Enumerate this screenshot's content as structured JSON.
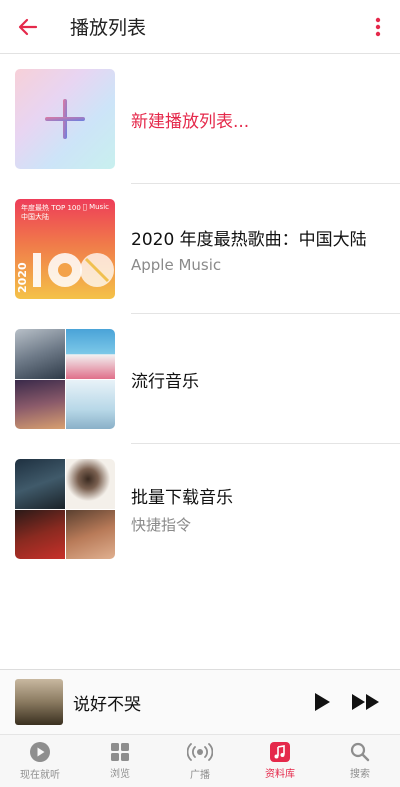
{
  "header": {
    "title": "播放列表"
  },
  "playlists": [
    {
      "title": "新建播放列表...",
      "subtitle": ""
    },
    {
      "title": "2020 年度最热歌曲：中国大陆",
      "subtitle": "Apple Music",
      "cover_lines": [
        "年度最热",
        "TOP 100",
        "中国大陆",
        "2020"
      ],
      "cover_brand": "Music"
    },
    {
      "title": "流行音乐",
      "subtitle": ""
    },
    {
      "title": "批量下载音乐",
      "subtitle": "快捷指令"
    }
  ],
  "mini_player": {
    "title": "说好不哭"
  },
  "tabs": [
    {
      "label": "现在就听",
      "icon": "play-circle-icon"
    },
    {
      "label": "浏览",
      "icon": "grid-icon"
    },
    {
      "label": "广播",
      "icon": "radio-icon"
    },
    {
      "label": "资料库",
      "icon": "music-note-icon",
      "active": true
    },
    {
      "label": "搜索",
      "icon": "search-icon"
    }
  ],
  "colors": {
    "accent": "#e5294b",
    "tab_inactive": "#8e8e8e",
    "subtitle": "#8a8a8a"
  }
}
